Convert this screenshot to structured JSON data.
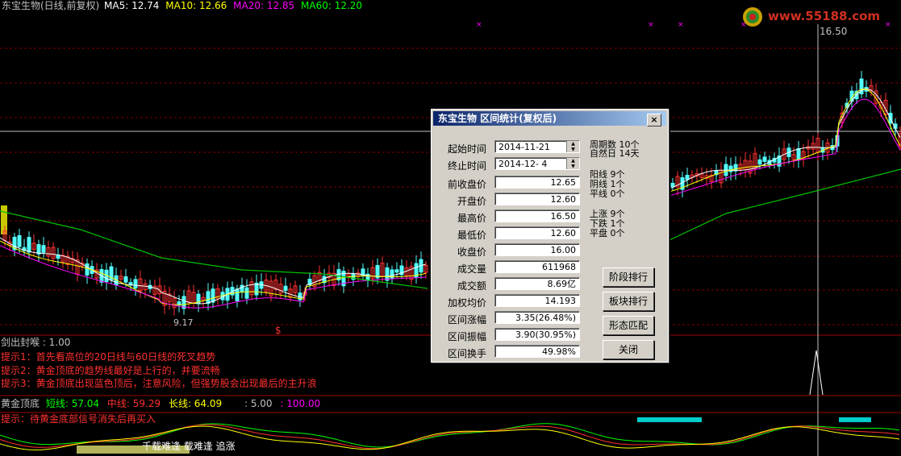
{
  "header": {
    "title": "东宝生物(日线,前复权)",
    "ma5": "MA5: 12.74",
    "ma10": "MA10: 12.66",
    "ma20": "MA20: 12.85",
    "ma60": "MA60: 12.20",
    "logo": "www.55188.com"
  },
  "price_labels": {
    "high": "16.50",
    "low": "9.17",
    "signal": "$"
  },
  "indicator1": {
    "name": "剑出封喉 : 1.00",
    "tips": [
      "提示1：首先看高位的20日线与60日线的死叉趋势",
      "提示2：黄金顶底的趋势线最好是上行的，并要流畅",
      "提示3：黄金顶底出现蓝色顶后，注意风险，但强势股会出现最后的主升浪"
    ]
  },
  "indicator2": {
    "name": "黄金顶底",
    "short": "短线: 57.04",
    "mid": "中线: 59.29",
    "long": "长线: 64.09",
    "v1": ": 5.00",
    "v2": ": 100.00",
    "tip": "提示：待黄金底部信号消失后再买入",
    "bottom_text": "千载难逢 载难逢  追涨"
  },
  "dialog": {
    "title": "东宝生物 区间统计(复权后)",
    "close": "×",
    "start_label": "起始时间",
    "start_value": "2014-11-21",
    "end_label": "终止时间",
    "end_value": "2014-12- 4",
    "rows": [
      {
        "label": "前收盘价",
        "value": "12.65"
      },
      {
        "label": "开盘价",
        "value": "12.60"
      },
      {
        "label": "最高价",
        "value": "16.50"
      },
      {
        "label": "最低价",
        "value": "12.60"
      },
      {
        "label": "收盘价",
        "value": "16.00"
      },
      {
        "label": "成交量",
        "value": "611968"
      },
      {
        "label": "成交额",
        "value": "8.69亿"
      },
      {
        "label": "加权均价",
        "value": "14.193"
      },
      {
        "label": "区间涨幅",
        "value": "3.35(26.48%)"
      },
      {
        "label": "区间振幅",
        "value": "3.90(30.95%)"
      },
      {
        "label": "区间换手",
        "value": "49.98%"
      }
    ],
    "stats": {
      "periods": "周期数 10个",
      "natural_days": "自然日 14天",
      "yang": "阳线  9个",
      "yin": "阴线  1个",
      "flat_line": "平线  0个",
      "up": "上涨  9个",
      "down": "下跌  1个",
      "flat": "平盘  0个"
    },
    "buttons": {
      "rank": "阶段排行",
      "sector": "板块排行",
      "pattern": "形态匹配",
      "close": "关闭"
    }
  },
  "colors": {
    "up": "#ff3232",
    "down": "#54ffff",
    "ma5": "#ffffff",
    "ma10": "#ffff00",
    "ma20": "#ff00ff",
    "ma60": "#00c000",
    "grid": "#800000",
    "tip": "#ff3030"
  }
}
